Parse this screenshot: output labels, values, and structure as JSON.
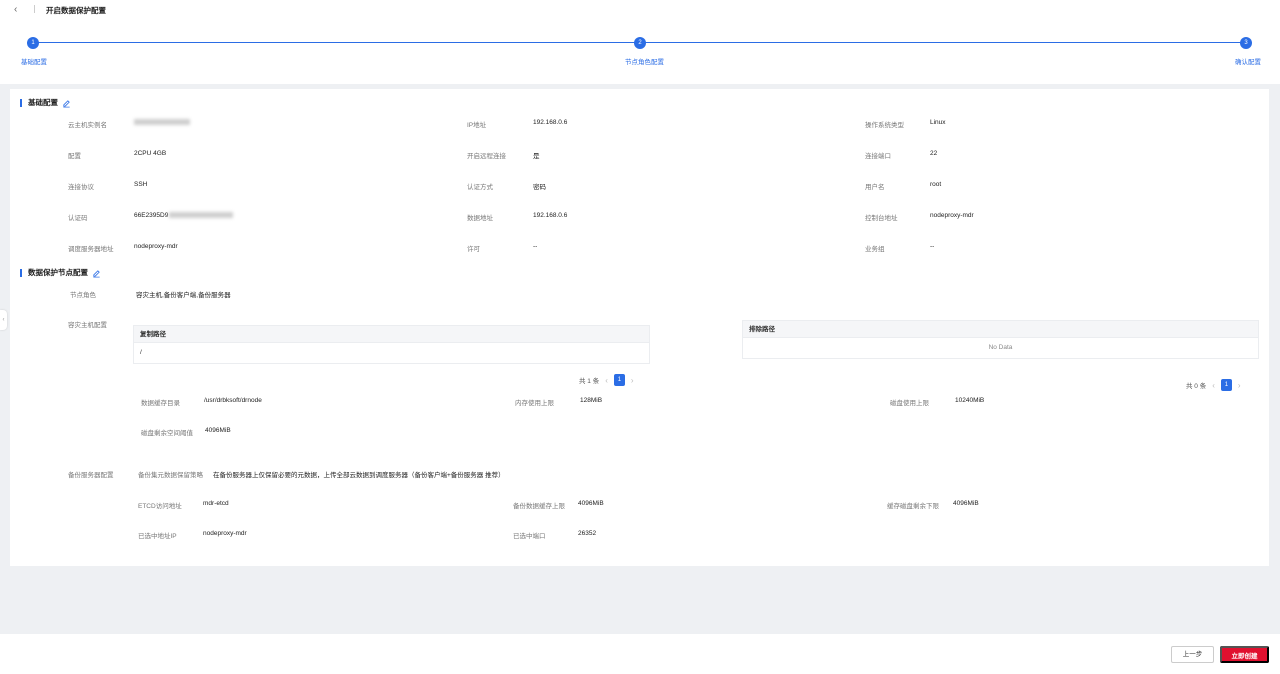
{
  "header": {
    "title": "开启数据保护配置"
  },
  "steps": [
    {
      "num": "1",
      "label": "基础配置"
    },
    {
      "num": "2",
      "label": "节点角色配置"
    },
    {
      "num": "3",
      "label": "确认配置"
    }
  ],
  "basic": {
    "title": "基础配置",
    "fields": {
      "instance_name_label": "云主机实例名",
      "instance_name_value": "",
      "ip_label": "IP地址",
      "ip_value": "192.168.0.6",
      "os_label": "操作系统类型",
      "os_value": "Linux",
      "spec_label": "配置",
      "spec_value": "2CPU 4GB",
      "remote_label": "开启远程连接",
      "remote_value": "是",
      "port_label": "连接端口",
      "port_value": "22",
      "protocol_label": "连接协议",
      "protocol_value": "SSH",
      "auth_label": "认证方式",
      "auth_value": "密码",
      "user_label": "用户名",
      "user_value": "root",
      "authcode_label": "认证码",
      "authcode_value": "66E2395D9",
      "data_addr_label": "数据地址",
      "data_addr_value": "192.168.0.6",
      "console_label": "控制台地址",
      "console_value": "nodeproxy-mdr",
      "scheduler_label": "调度服务器地址",
      "scheduler_value": "nodeproxy-mdr",
      "license_label": "许可",
      "license_value": "--",
      "biz_label": "业务组",
      "biz_value": "--"
    }
  },
  "node": {
    "title": "数据保护节点配置",
    "role_label": "节点角色",
    "role_value": "容灾主机,备份客户端,备份服务器",
    "dr_label": "容灾主机配置",
    "copy_table": {
      "header": "复制路径",
      "rows": [
        "/"
      ],
      "total": "共 1 条",
      "page": "1"
    },
    "exclude_table": {
      "header": "排除路径",
      "empty": "No Data",
      "total": "共 0 条",
      "page": "1"
    },
    "cache_dir_label": "数据缓存目录",
    "cache_dir_value": "/usr/drbksoft/drnode",
    "mem_limit_label": "内存使用上限",
    "mem_limit_value": "128MiB",
    "disk_limit_label": "磁盘使用上限",
    "disk_limit_value": "10240MiB",
    "disk_free_label": "磁盘剩余空间阈值",
    "disk_free_value": "4096MiB",
    "backup_label": "备份服务器配置",
    "policy_label": "备份集元数据保留策略",
    "policy_value": "在备份服务器上仅保留必要的元数据，上传全部云数据到调度服务器（备份客户端+备份服务器 推荐）",
    "etcd_label": "ETCD访问地址",
    "etcd_value": "mdr-etcd",
    "backup_cache_label": "备份数据缓存上限",
    "backup_cache_value": "4096MiB",
    "cache_disk_label": "缓存磁盘剩余下限",
    "cache_disk_value": "4096MiB",
    "sel_addr_label": "已选中地址IP",
    "sel_addr_value": "nodeproxy-mdr",
    "sel_port_label": "已选中端口",
    "sel_port_value": "26352"
  },
  "footer": {
    "prev_label": "上一步",
    "create_label": "立即创建"
  },
  "colors": {
    "accent": "#2b6de5",
    "danger": "#e0102f"
  }
}
